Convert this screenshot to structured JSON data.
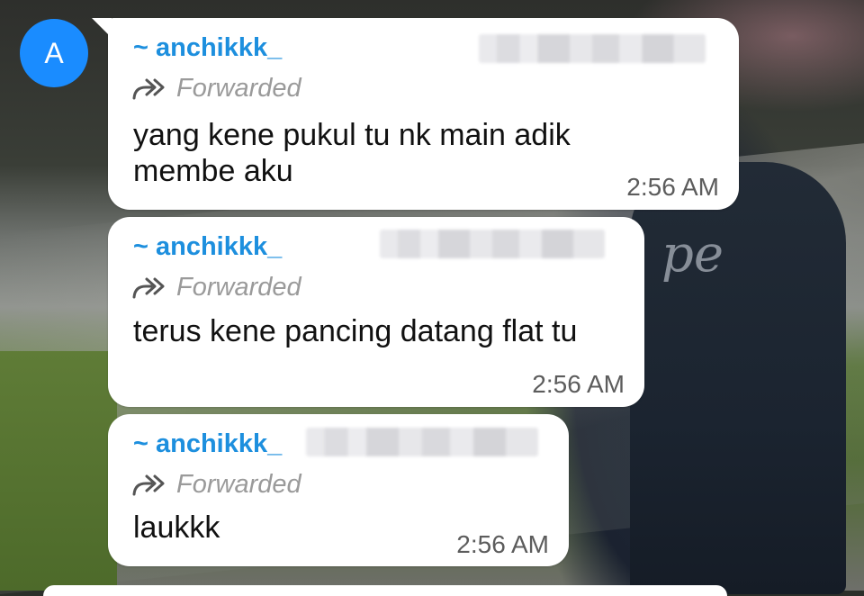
{
  "avatar": {
    "letter": "A"
  },
  "messages": [
    {
      "sender": "~ anchikkk_",
      "forwarded_label": "Forwarded",
      "text": "yang kene pukul tu nk main adik membe aku",
      "time": "2:56 AM"
    },
    {
      "sender": "~ anchikkk_",
      "forwarded_label": "Forwarded",
      "text": "terus kene pancing datang flat tu",
      "time": "2:56 AM"
    },
    {
      "sender": "~ anchikkk_",
      "forwarded_label": "Forwarded",
      "text": "laukkk",
      "time": "2:56 AM"
    }
  ],
  "colors": {
    "sender": "#1d8fde",
    "avatar": "#1a8cff",
    "bubble": "#ffffff",
    "forwarded": "#9a9a9a"
  },
  "icons": {
    "forward": "forward-arrow-icon"
  }
}
